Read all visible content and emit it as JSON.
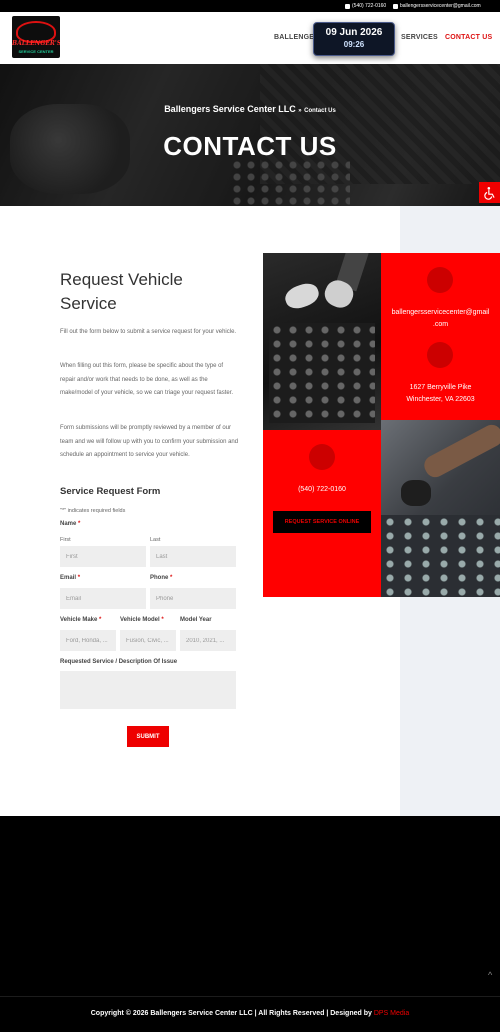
{
  "topbar": {
    "phone": "(540) 722-0160",
    "email": "ballengersservicecenter@gmail.com"
  },
  "header": {
    "logo_text": "BALLENGER'S",
    "logo_subtext": "SERVICE CENTER",
    "nav": [
      "BALLENGERS",
      "SERVICES",
      "CONTACT US"
    ],
    "active_color": "#dd1111"
  },
  "clock": {
    "date": "09 Jun 2026",
    "time": "09:26"
  },
  "hero": {
    "crumb_home": "Ballengers Service Center LLC",
    "crumb_sep": "»",
    "crumb_current": "Contact Us",
    "title": "CONTACT US"
  },
  "form_section": {
    "title": "Request Vehicle Service",
    "intro": [
      "Fill out the form below to submit a service request for your vehicle.",
      "When filling out this form, please be specific about the type of repair and/or work that needs to be done, as well as the make/model of your vehicle, so we can triage your request faster.",
      "Form submissions will be promptly reviewed by a member of our team and we will follow up with you to confirm your submission and schedule an appointment to service your vehicle."
    ],
    "subtitle": "Service Request Form",
    "required_note": "\"*\" indicates required fields",
    "name_label": "Name",
    "first_label": "First",
    "last_label": "Last",
    "first_placeholder": "First",
    "last_placeholder": "Last",
    "email_label": "Email",
    "email_placeholder": "Email",
    "phone_label": "Phone",
    "phone_placeholder": "Phone",
    "make_label": "Vehicle Make",
    "make_placeholder": "Ford, Honda, ...",
    "model_label": "Vehicle Model",
    "model_placeholder": "Fusion, Civic, ...",
    "year_label": "Model Year",
    "year_placeholder": "2010, 2021, ...",
    "desc_label": "Requested Service / Description Of Issue",
    "required_star": "*",
    "submit": "SUBMIT"
  },
  "contact_grid": {
    "email_lines": [
      "ballengersservicecenter@gmail",
      ".com"
    ],
    "address_lines": [
      "1627 Berryville Pike",
      "Winchester, VA 22603"
    ],
    "phone": "(540) 722-0160",
    "cta": "REQUEST SERVICE ONLINE",
    "accent": "#ff0000"
  },
  "footer": {
    "copyright": "Copyright © 2026 Ballengers Service Center LLC | All Rights Reserved | Designed by",
    "designer": "DPS Media",
    "to_top": "^"
  }
}
